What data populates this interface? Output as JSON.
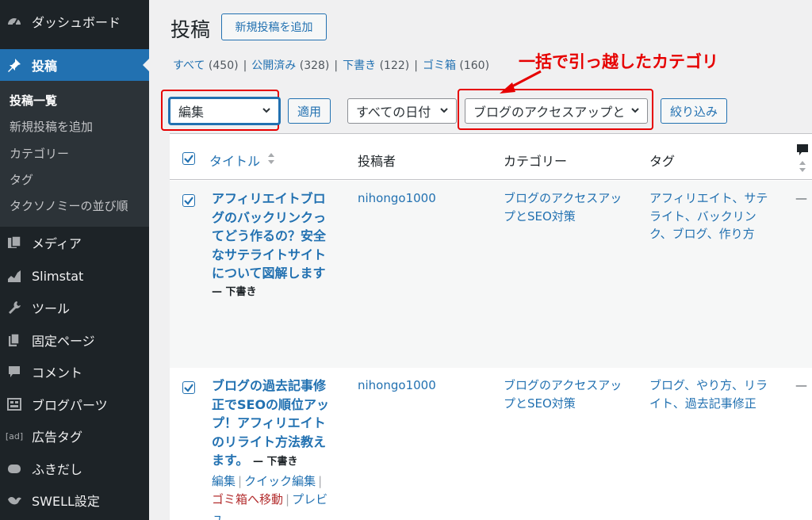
{
  "sidebar": {
    "items": [
      {
        "label": "ダッシュボード",
        "icon": "dashboard-icon"
      },
      {
        "label": "投稿",
        "icon": "pushpin-icon"
      },
      {
        "label": "メディア",
        "icon": "media-icon"
      },
      {
        "label": "Slimstat",
        "icon": "chart-area-icon"
      },
      {
        "label": "ツール",
        "icon": "wrench-icon"
      },
      {
        "label": "固定ページ",
        "icon": "page-icon"
      },
      {
        "label": "コメント",
        "icon": "comment-icon"
      },
      {
        "label": "ブログパーツ",
        "icon": "layout-icon"
      },
      {
        "label": "広告タグ",
        "icon_text": "[ad]"
      },
      {
        "label": "ふきだし",
        "icon": "bubble-icon"
      },
      {
        "label": "SWELL設定",
        "icon": "swell-bird-icon"
      }
    ],
    "submenu": [
      "投稿一覧",
      "新規投稿を追加",
      "カテゴリー",
      "タグ",
      "タクソノミーの並び順"
    ]
  },
  "header": {
    "title": "投稿",
    "add_new": "新規投稿を追加"
  },
  "filters": {
    "all": "すべて",
    "all_count": "(450)",
    "published": "公開済み",
    "published_count": "(328)",
    "draft": "下書き",
    "draft_count": "(122)",
    "trash": "ゴミ箱",
    "trash_count": "(160)",
    "separator": "|"
  },
  "annotation": "一括で引っ越したカテゴリ",
  "toolbar": {
    "bulk_action": "編集",
    "apply": "適用",
    "dates": "すべての日付",
    "category": "ブログのアクセスアップと",
    "filter": "絞り込み"
  },
  "table": {
    "columns": [
      "タイトル",
      "投稿者",
      "カテゴリー",
      "タグ"
    ],
    "rows": [
      {
        "title_lines": [
          "アフィリエイトブロ",
          "グのバックリンクっ",
          "てどう作るの？安全",
          "なサテライトサイト",
          "について図解します"
        ],
        "state": "— 下書き",
        "author": "nihongo1000",
        "category_lines": [
          "ブログのアクセスアッ",
          "プとSEO対策"
        ],
        "tag_lines": [
          "アフィリエイト、サテ",
          "ライト、バックリン",
          "ク、ブログ、作り方"
        ],
        "comments": "—"
      },
      {
        "title_lines": [
          "ブログの過去記事修",
          "正でSEOの順位アッ",
          "プ！アフィリエイト",
          "のリライト方法教え",
          "ます。"
        ],
        "state": "— 下書き",
        "author": "nihongo1000",
        "category_lines": [
          "ブログのアクセスアッ",
          "プとSEO対策"
        ],
        "tag_lines": [
          "ブログ、やり方、リラ",
          "イト、過去記事修正"
        ],
        "comments": "—",
        "actions": {
          "edit": "編集",
          "quick_edit": "クイック編集",
          "trash": "ゴミ箱へ移動",
          "preview": "プレビ",
          "preview_tail": "ュ"
        }
      }
    ]
  },
  "colors": {
    "accent": "#2271b1",
    "sidebar": "#1d2327",
    "annotation": "#e60000"
  }
}
